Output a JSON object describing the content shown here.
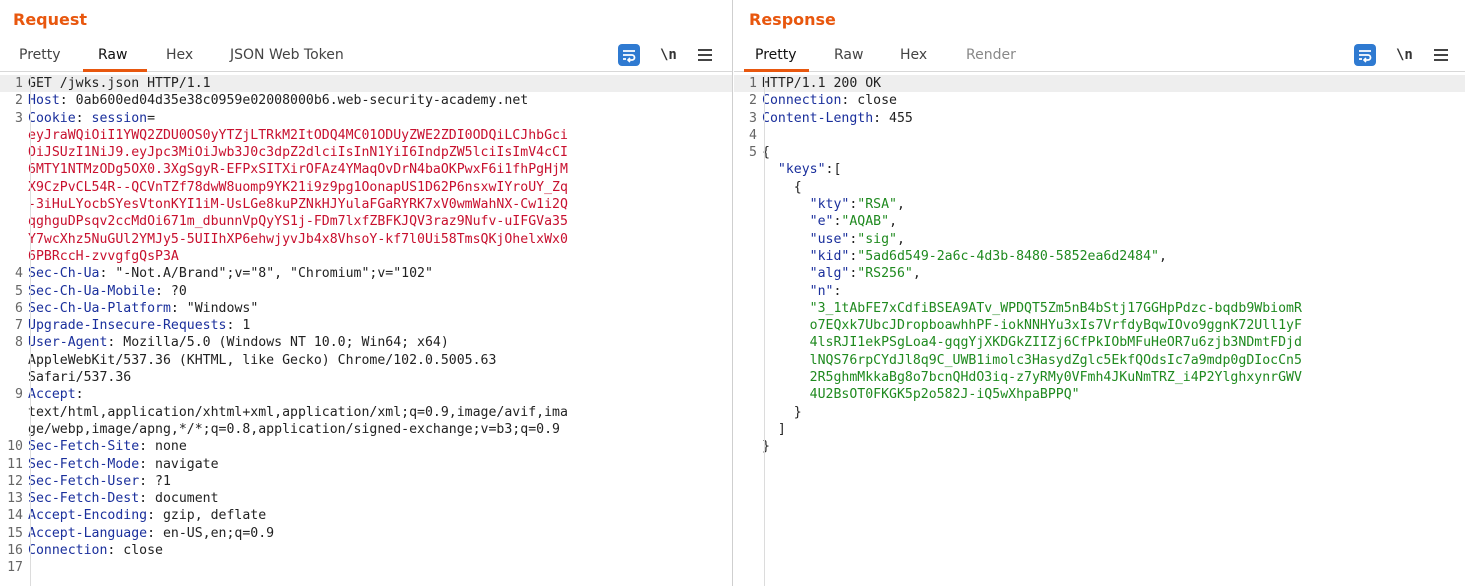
{
  "layout_controls": [
    "split-horizontal",
    "split-vertical",
    "single"
  ],
  "request": {
    "title": "Request",
    "tabs": [
      {
        "label": "Pretty"
      },
      {
        "label": "Raw"
      },
      {
        "label": "Hex"
      },
      {
        "label": "JSON Web Token"
      }
    ],
    "active_tab": "Raw",
    "newline_label": "\\n",
    "lines": [
      {
        "n": "1",
        "parts": [
          {
            "t": "GET /jwks.json HTTP/1.1",
            "c": "hval"
          }
        ]
      },
      {
        "n": "2",
        "parts": [
          {
            "t": "Host",
            "c": "hkey"
          },
          {
            "t": ": 0ab600ed04d35e38c0959e02008000b6.web-security-academy.net",
            "c": "hval"
          }
        ]
      },
      {
        "n": "3",
        "parts": [
          {
            "t": "Cookie",
            "c": "hkey"
          },
          {
            "t": ": ",
            "c": "hval"
          },
          {
            "t": "session",
            "c": "hkey"
          },
          {
            "t": "=",
            "c": "hval"
          }
        ]
      },
      {
        "n": "",
        "parts": [
          {
            "t": "eyJraWQiOiI1YWQ2ZDU0OS0yYTZjLTRkM2ItODQ4MC01ODUyZWE2ZDI0ODQiLCJhbGci",
            "c": "red"
          }
        ]
      },
      {
        "n": "",
        "parts": [
          {
            "t": "OiJSUzI1NiJ9.eyJpc3MiOiJwb3J0c3dpZ2dlciIsInN1YiI6IndpZW5lciIsImV4cCI",
            "c": "red"
          }
        ]
      },
      {
        "n": "",
        "parts": [
          {
            "t": "6MTY1NTMzODg5OX0.3XgSgyR-EFPxSITXirOFAz4YMaqOvDrN4baOKPwxF6i1fhPgHjM",
            "c": "red"
          }
        ]
      },
      {
        "n": "",
        "parts": [
          {
            "t": "X9CzPvCL54R--QCVnTZf78dwW8uomp9YK21i9z9pg1OonapUS1D62P6nsxwIYroUY_Zq",
            "c": "red"
          }
        ]
      },
      {
        "n": "",
        "parts": [
          {
            "t": "-3iHuLYocbSYesVtonKYI1iM-UsLGe8kuPZNkHJYulaFGaRYRK7xV0wmWahNX-Cw1i2Q",
            "c": "red"
          }
        ]
      },
      {
        "n": "",
        "parts": [
          {
            "t": "qghguDPsqv2ccMdOi671m_dbunnVpQyYS1j-FDm7lxfZBFKJQV3raz9Nufv-uIFGVa35",
            "c": "red"
          }
        ]
      },
      {
        "n": "",
        "parts": [
          {
            "t": "Y7wcXhz5NuGUl2YMJy5-5UIIhXP6ehwjyvJb4x8VhsoY-kf7l0Ui58TmsQKjOhelxWx0",
            "c": "red"
          }
        ]
      },
      {
        "n": "",
        "parts": [
          {
            "t": "6PBRccH-zvvgfgQsP3A",
            "c": "red"
          }
        ]
      },
      {
        "n": "4",
        "parts": [
          {
            "t": "Sec-Ch-Ua",
            "c": "hkey"
          },
          {
            "t": ": \"-Not.A/Brand\";v=\"8\", \"Chromium\";v=\"102\"",
            "c": "hval"
          }
        ]
      },
      {
        "n": "5",
        "parts": [
          {
            "t": "Sec-Ch-Ua-Mobile",
            "c": "hkey"
          },
          {
            "t": ": ?0",
            "c": "hval"
          }
        ]
      },
      {
        "n": "6",
        "parts": [
          {
            "t": "Sec-Ch-Ua-Platform",
            "c": "hkey"
          },
          {
            "t": ": \"Windows\"",
            "c": "hval"
          }
        ]
      },
      {
        "n": "7",
        "parts": [
          {
            "t": "Upgrade-Insecure-Requests",
            "c": "hkey"
          },
          {
            "t": ": 1",
            "c": "hval"
          }
        ]
      },
      {
        "n": "8",
        "parts": [
          {
            "t": "User-Agent",
            "c": "hkey"
          },
          {
            "t": ": Mozilla/5.0 (Windows NT 10.0; Win64; x64)",
            "c": "hval"
          }
        ]
      },
      {
        "n": "",
        "parts": [
          {
            "t": "AppleWebKit/537.36 (KHTML, like Gecko) Chrome/102.0.5005.63",
            "c": "hval"
          }
        ]
      },
      {
        "n": "",
        "parts": [
          {
            "t": "Safari/537.36",
            "c": "hval"
          }
        ]
      },
      {
        "n": "9",
        "parts": [
          {
            "t": "Accept",
            "c": "hkey"
          },
          {
            "t": ":",
            "c": "hval"
          }
        ]
      },
      {
        "n": "",
        "parts": [
          {
            "t": "text/html,application/xhtml+xml,application/xml;q=0.9,image/avif,ima",
            "c": "hval"
          }
        ]
      },
      {
        "n": "",
        "parts": [
          {
            "t": "ge/webp,image/apng,*/*;q=0.8,application/signed-exchange;v=b3;q=0.9",
            "c": "hval"
          }
        ]
      },
      {
        "n": "10",
        "parts": [
          {
            "t": "Sec-Fetch-Site",
            "c": "hkey"
          },
          {
            "t": ": none",
            "c": "hval"
          }
        ]
      },
      {
        "n": "11",
        "parts": [
          {
            "t": "Sec-Fetch-Mode",
            "c": "hkey"
          },
          {
            "t": ": navigate",
            "c": "hval"
          }
        ]
      },
      {
        "n": "12",
        "parts": [
          {
            "t": "Sec-Fetch-User",
            "c": "hkey"
          },
          {
            "t": ": ?1",
            "c": "hval"
          }
        ]
      },
      {
        "n": "13",
        "parts": [
          {
            "t": "Sec-Fetch-Dest",
            "c": "hkey"
          },
          {
            "t": ": document",
            "c": "hval"
          }
        ]
      },
      {
        "n": "14",
        "parts": [
          {
            "t": "Accept-Encoding",
            "c": "hkey"
          },
          {
            "t": ": gzip, deflate",
            "c": "hval"
          }
        ]
      },
      {
        "n": "15",
        "parts": [
          {
            "t": "Accept-Language",
            "c": "hkey"
          },
          {
            "t": ": en-US,en;q=0.9",
            "c": "hval"
          }
        ]
      },
      {
        "n": "16",
        "parts": [
          {
            "t": "Connection",
            "c": "hkey"
          },
          {
            "t": ": close",
            "c": "hval"
          }
        ]
      },
      {
        "n": "17",
        "parts": [
          {
            "t": "",
            "c": "hval"
          }
        ]
      }
    ]
  },
  "response": {
    "title": "Response",
    "tabs": [
      {
        "label": "Pretty"
      },
      {
        "label": "Raw"
      },
      {
        "label": "Hex"
      },
      {
        "label": "Render"
      }
    ],
    "active_tab": "Pretty",
    "newline_label": "\\n",
    "lines": [
      {
        "n": "1",
        "parts": [
          {
            "t": "HTTP/1.1 200 OK",
            "c": "hval"
          }
        ]
      },
      {
        "n": "2",
        "parts": [
          {
            "t": "Connection",
            "c": "hkey"
          },
          {
            "t": ": close",
            "c": "hval"
          }
        ]
      },
      {
        "n": "3",
        "parts": [
          {
            "t": "Content-Length",
            "c": "hkey"
          },
          {
            "t": ": 455",
            "c": "hval"
          }
        ]
      },
      {
        "n": "4",
        "parts": [
          {
            "t": "",
            "c": "hval"
          }
        ]
      },
      {
        "n": "5",
        "parts": [
          {
            "t": "{",
            "c": "jpunc"
          }
        ]
      },
      {
        "n": "",
        "parts": [
          {
            "t": "  ",
            "c": "jpunc"
          },
          {
            "t": "\"keys\"",
            "c": "jkey"
          },
          {
            "t": ":[",
            "c": "jpunc"
          }
        ]
      },
      {
        "n": "",
        "parts": [
          {
            "t": "    {",
            "c": "jpunc"
          }
        ]
      },
      {
        "n": "",
        "parts": [
          {
            "t": "      ",
            "c": "jpunc"
          },
          {
            "t": "\"kty\"",
            "c": "jkey"
          },
          {
            "t": ":",
            "c": "jpunc"
          },
          {
            "t": "\"RSA\"",
            "c": "jstr"
          },
          {
            "t": ",",
            "c": "jpunc"
          }
        ]
      },
      {
        "n": "",
        "parts": [
          {
            "t": "      ",
            "c": "jpunc"
          },
          {
            "t": "\"e\"",
            "c": "jkey"
          },
          {
            "t": ":",
            "c": "jpunc"
          },
          {
            "t": "\"AQAB\"",
            "c": "jstr"
          },
          {
            "t": ",",
            "c": "jpunc"
          }
        ]
      },
      {
        "n": "",
        "parts": [
          {
            "t": "      ",
            "c": "jpunc"
          },
          {
            "t": "\"use\"",
            "c": "jkey"
          },
          {
            "t": ":",
            "c": "jpunc"
          },
          {
            "t": "\"sig\"",
            "c": "jstr"
          },
          {
            "t": ",",
            "c": "jpunc"
          }
        ]
      },
      {
        "n": "",
        "parts": [
          {
            "t": "      ",
            "c": "jpunc"
          },
          {
            "t": "\"kid\"",
            "c": "jkey"
          },
          {
            "t": ":",
            "c": "jpunc"
          },
          {
            "t": "\"5ad6d549-2a6c-4d3b-8480-5852ea6d2484\"",
            "c": "jstr"
          },
          {
            "t": ",",
            "c": "jpunc"
          }
        ]
      },
      {
        "n": "",
        "parts": [
          {
            "t": "      ",
            "c": "jpunc"
          },
          {
            "t": "\"alg\"",
            "c": "jkey"
          },
          {
            "t": ":",
            "c": "jpunc"
          },
          {
            "t": "\"RS256\"",
            "c": "jstr"
          },
          {
            "t": ",",
            "c": "jpunc"
          }
        ]
      },
      {
        "n": "",
        "parts": [
          {
            "t": "      ",
            "c": "jpunc"
          },
          {
            "t": "\"n\"",
            "c": "jkey"
          },
          {
            "t": ":",
            "c": "jpunc"
          }
        ]
      },
      {
        "n": "",
        "parts": [
          {
            "t": "      ",
            "c": "jpunc"
          },
          {
            "t": "\"3_1tAbFE7xCdfiBSEA9ATv_WPDQT5Zm5nB4bStj17GGHpPdzc-bqdb9WbiomR",
            "c": "jstr"
          }
        ]
      },
      {
        "n": "",
        "parts": [
          {
            "t": "      ",
            "c": "jpunc"
          },
          {
            "t": "o7EQxk7UbcJDropboawhhPF-iokNNHYu3xIs7VrfdyBqwIOvo9ggnK72Ull1yF",
            "c": "jstr"
          }
        ]
      },
      {
        "n": "",
        "parts": [
          {
            "t": "      ",
            "c": "jpunc"
          },
          {
            "t": "4lsRJI1ekPSgLoa4-gqgYjXKDGkZIIZj6CfPkIObMFuHeOR7u6zjb3NDmtFDjd",
            "c": "jstr"
          }
        ]
      },
      {
        "n": "",
        "parts": [
          {
            "t": "      ",
            "c": "jpunc"
          },
          {
            "t": "lNQS76rpCYdJl8q9C_UWB1imolc3HasydZglc5EkfQOdsIc7a9mdp0gDIocCn5",
            "c": "jstr"
          }
        ]
      },
      {
        "n": "",
        "parts": [
          {
            "t": "      ",
            "c": "jpunc"
          },
          {
            "t": "2R5ghmMkkaBg8o7bcnQHdO3iq-z7yRMy0VFmh4JKuNmTRZ_i4P2YlghxynrGWV",
            "c": "jstr"
          }
        ]
      },
      {
        "n": "",
        "parts": [
          {
            "t": "      ",
            "c": "jpunc"
          },
          {
            "t": "4U2BsOT0FKGK5p2o582J-iQ5wXhpaBPPQ\"",
            "c": "jstr"
          }
        ]
      },
      {
        "n": "",
        "parts": [
          {
            "t": "    }",
            "c": "jpunc"
          }
        ]
      },
      {
        "n": "",
        "parts": [
          {
            "t": "  ]",
            "c": "jpunc"
          }
        ]
      },
      {
        "n": "",
        "parts": [
          {
            "t": "}",
            "c": "jpunc"
          }
        ]
      }
    ]
  },
  "colors": {
    "accent": "#e8570e",
    "header_key": "#1a2f9c",
    "cookie_value": "#c8102e",
    "json_string": "#1f8a1f",
    "tool_blue": "#2f7ad1"
  },
  "icons": [
    "wrap-lines-icon",
    "newline-toggle-icon",
    "menu-icon"
  ]
}
